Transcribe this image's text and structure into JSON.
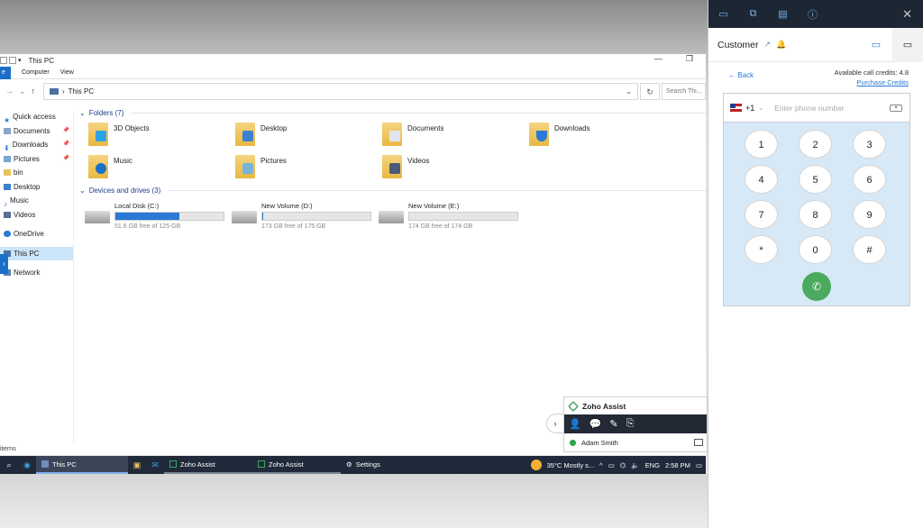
{
  "explorer": {
    "title": "This PC",
    "ribbon": [
      "File",
      "Computer",
      "View"
    ],
    "address": "This PC",
    "search_placeholder": "Search Thi...",
    "sidebar": [
      {
        "label": "Quick access",
        "pinned": false
      },
      {
        "label": "Documents",
        "pinned": true
      },
      {
        "label": "Downloads",
        "pinned": true
      },
      {
        "label": "Pictures",
        "pinned": true
      },
      {
        "label": "bin",
        "pinned": false
      },
      {
        "label": "Desktop",
        "pinned": false
      },
      {
        "label": "Music",
        "pinned": false
      },
      {
        "label": "Videos",
        "pinned": false
      },
      {
        "label": "OneDrive",
        "pinned": false
      },
      {
        "label": "This PC",
        "pinned": false,
        "selected": true
      },
      {
        "label": "Network",
        "pinned": false
      }
    ],
    "folders_header": "Folders (7)",
    "folders": [
      {
        "label": "3D Objects",
        "icon": "3d-objects-folder-icon"
      },
      {
        "label": "Desktop",
        "icon": "desktop-folder-icon"
      },
      {
        "label": "Documents",
        "icon": "documents-folder-icon"
      },
      {
        "label": "Downloads",
        "icon": "downloads-folder-icon"
      },
      {
        "label": "Music",
        "icon": "music-folder-icon"
      },
      {
        "label": "Pictures",
        "icon": "pictures-folder-icon"
      },
      {
        "label": "Videos",
        "icon": "videos-folder-icon"
      }
    ],
    "drives_header": "Devices and drives (3)",
    "drives": [
      {
        "label": "Local Disk (C:)",
        "free": "51.6 GB free of 125 GB",
        "used_fraction": 0.59
      },
      {
        "label": "New Volume (D:)",
        "free": "173 GB free of 175 GB",
        "used_fraction": 0.01
      },
      {
        "label": "New Volume (E:)",
        "free": "174 GB free of 174 GB",
        "used_fraction": 0.0
      }
    ],
    "status": "items"
  },
  "taskbar": {
    "apps": [
      "This PC",
      "Zoho Assist",
      "Zoho Assist",
      "Settings"
    ],
    "weather": "35°C  Mostly s...",
    "lang": "ENG",
    "time": "2:58 PM"
  },
  "zoho_widget": {
    "title": "Zoho Assist",
    "user": "Adam Smith"
  },
  "panel": {
    "title": "Customer",
    "back": "Back",
    "credits": "Available call credits: 4.8",
    "purchase": "Purchase Credits",
    "country_code": "+1",
    "phone_placeholder": "Enter phone number",
    "keys": [
      "1",
      "2",
      "3",
      "4",
      "5",
      "6",
      "7",
      "8",
      "9",
      "*",
      "0",
      "#"
    ]
  },
  "colors": {
    "accent": "#2a7ad6",
    "call": "#4aaa5d",
    "dialer_bg": "#d7e8f6",
    "taskbar": "#202a3a"
  }
}
